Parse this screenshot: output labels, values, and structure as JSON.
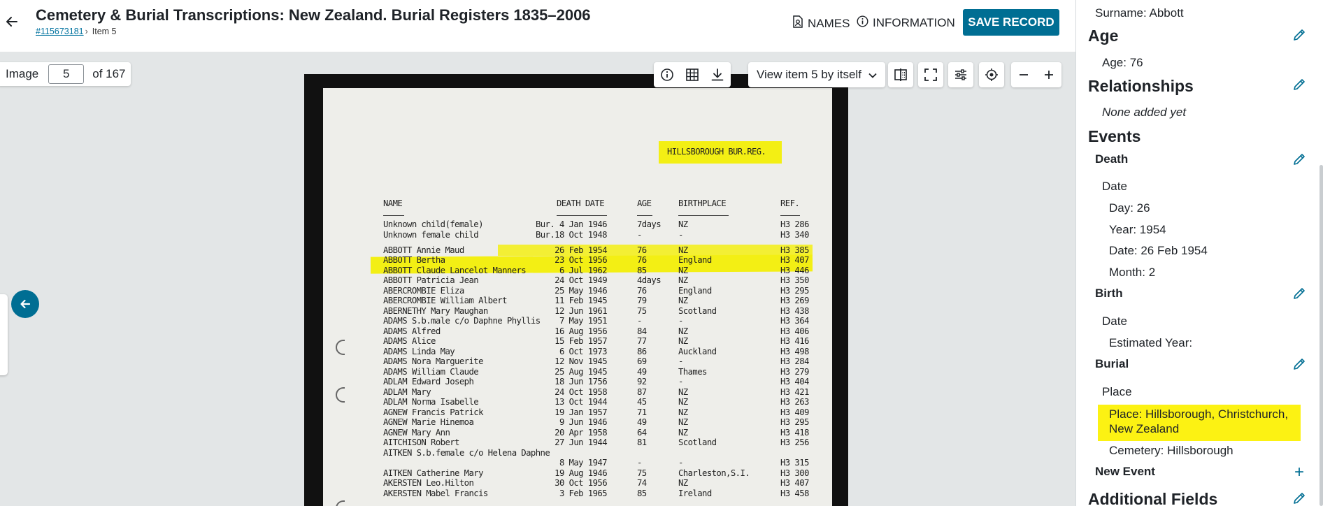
{
  "header": {
    "title": "Cemetery & Burial Transcriptions: New Zealand. Burial Registers 1835–2006",
    "record_id": "#115673181",
    "breadcrumb_sep": "›",
    "item": "Item 5",
    "names_label": "NAMES",
    "info_label": "INFORMATION",
    "save_label": "SAVE RECORD"
  },
  "viewer": {
    "image_label": "Image",
    "image_number": "5",
    "image_total": "of 167",
    "view_select": "View item 5 by itself",
    "colors": {
      "accent": "#006e93",
      "highlight": "#f3ef14"
    }
  },
  "document": {
    "register_header": "HILLSBOROUGH BUR.REG.",
    "columns": {
      "name": "NAME",
      "death_date": "DEATH DATE",
      "age": "AGE",
      "birthplace": "BIRTHPLACE",
      "ref": "REF."
    },
    "rows": [
      {
        "name": "Unknown child(female)",
        "date": "Bur. 4 Jan 1946",
        "age": "7days",
        "birthplace": "NZ",
        "ref": "H3 286"
      },
      {
        "name": "Unknown female child",
        "date": "Bur.18 Oct 1948",
        "age": "-",
        "birthplace": "-",
        "ref": "H3 340"
      },
      {
        "name": "ABBOTT Annie Maud",
        "date": "26 Feb 1954",
        "age": "76",
        "birthplace": "NZ",
        "ref": "H3 385"
      },
      {
        "name": "ABBOTT Bertha",
        "date": "23 Oct 1956",
        "age": "76",
        "birthplace": "England",
        "ref": "H3 407"
      },
      {
        "name": "ABBOTT Claude Lancelot Manners",
        "date": "6 Jul 1962",
        "age": "85",
        "birthplace": "NZ",
        "ref": "H3 446"
      },
      {
        "name": "ABBOTT Patricia Jean",
        "date": "24 Oct 1949",
        "age": "4days",
        "birthplace": "NZ",
        "ref": "H3 350"
      },
      {
        "name": "ABERCROMBIE Eliza",
        "date": "25 May 1946",
        "age": "76",
        "birthplace": "England",
        "ref": "H3 295"
      },
      {
        "name": "ABERCROMBIE William Albert",
        "date": "11 Feb 1945",
        "age": "79",
        "birthplace": "NZ",
        "ref": "H3 269"
      },
      {
        "name": "ABERNETHY Mary Maughan",
        "date": "12 Jun 1961",
        "age": "75",
        "birthplace": "Scotland",
        "ref": "H3 438"
      },
      {
        "name": "ADAMS S.b.male c/o Daphne Phyllis",
        "date": "7 May 1951",
        "age": "-",
        "birthplace": "-",
        "ref": "H3 364"
      },
      {
        "name": "ADAMS Alfred",
        "date": "16 Aug 1956",
        "age": "84",
        "birthplace": "NZ",
        "ref": "H3 406"
      },
      {
        "name": "ADAMS Alice",
        "date": "15 Feb 1957",
        "age": "77",
        "birthplace": "NZ",
        "ref": "H3 416"
      },
      {
        "name": "ADAMS Linda May",
        "date": "6 Oct 1973",
        "age": "86",
        "birthplace": "Auckland",
        "ref": "H3 498"
      },
      {
        "name": "ADAMS Nora Marguerite",
        "date": "12 Nov 1945",
        "age": "69",
        "birthplace": "-",
        "ref": "H3 284"
      },
      {
        "name": "ADAMS William Claude",
        "date": "25 Aug 1945",
        "age": "49",
        "birthplace": "Thames",
        "ref": "H3 279"
      },
      {
        "name": "ADLAM Edward Joseph",
        "date": "18 Jun 1756",
        "age": "92",
        "birthplace": "-",
        "ref": "H3 404"
      },
      {
        "name": "ADLAM Mary",
        "date": "24 Oct 1958",
        "age": "87",
        "birthplace": "NZ",
        "ref": "H3 421"
      },
      {
        "name": "ADLAM Norma Isabelle",
        "date": "13 Oct 1944",
        "age": "45",
        "birthplace": "NZ",
        "ref": "H3 263"
      },
      {
        "name": "AGNEW Francis Patrick",
        "date": "19 Jan 1957",
        "age": "71",
        "birthplace": "NZ",
        "ref": "H3 409"
      },
      {
        "name": "AGNEW Marie Hinemoa",
        "date": "9 Jun 1946",
        "age": "49",
        "birthplace": "NZ",
        "ref": "H3 295"
      },
      {
        "name": "AGNEW Mary Ann",
        "date": "20 Apr 1958",
        "age": "64",
        "birthplace": "NZ",
        "ref": "H3 418"
      },
      {
        "name": "AITCHISON Robert",
        "date": "27 Jun 1944",
        "age": "81",
        "birthplace": "Scotland",
        "ref": "H3 256"
      },
      {
        "name": "AITKEN S.b.female c/o Helena Daphne",
        "date": "",
        "age": "",
        "birthplace": "",
        "ref": ""
      },
      {
        "name": "",
        "date": "8 May 1947",
        "age": "-",
        "birthplace": "-",
        "ref": "H3 315"
      },
      {
        "name": "AITKEN Catherine Mary",
        "date": "19 Aug 1946",
        "age": "75",
        "birthplace": "Charleston,S.I.",
        "ref": "H3 300"
      },
      {
        "name": "AKERSTEN Leo.Hilton",
        "date": "30 Oct 1956",
        "age": "74",
        "birthplace": "NZ",
        "ref": "H3 407"
      },
      {
        "name": "AKERSTEN Mabel Francis",
        "date": "3 Feb 1965",
        "age": "85",
        "birthplace": "Ireland",
        "ref": "H3 458"
      }
    ]
  },
  "panel": {
    "surname": "Surname: Abbott",
    "age_title": "Age",
    "age_value": "Age: 76",
    "relationships_title": "Relationships",
    "relationships_value": "None added yet",
    "events_title": "Events",
    "death_title": "Death",
    "death_date_label": "Date",
    "death_day": "Day: 26",
    "death_year": "Year: 1954",
    "death_date": "Date: 26 Feb 1954",
    "death_month": "Month: 2",
    "birth_title": "Birth",
    "birth_date_label": "Date",
    "birth_est_year": "Estimated Year:",
    "burial_title": "Burial",
    "burial_place_label": "Place",
    "burial_place_line1": "Place: Hillsborough, Christchurch,",
    "burial_place_line2": "New Zealand",
    "burial_cemetery": "Cemetery: Hillsborough",
    "new_event": "New Event",
    "additional_fields": "Additional Fields"
  }
}
